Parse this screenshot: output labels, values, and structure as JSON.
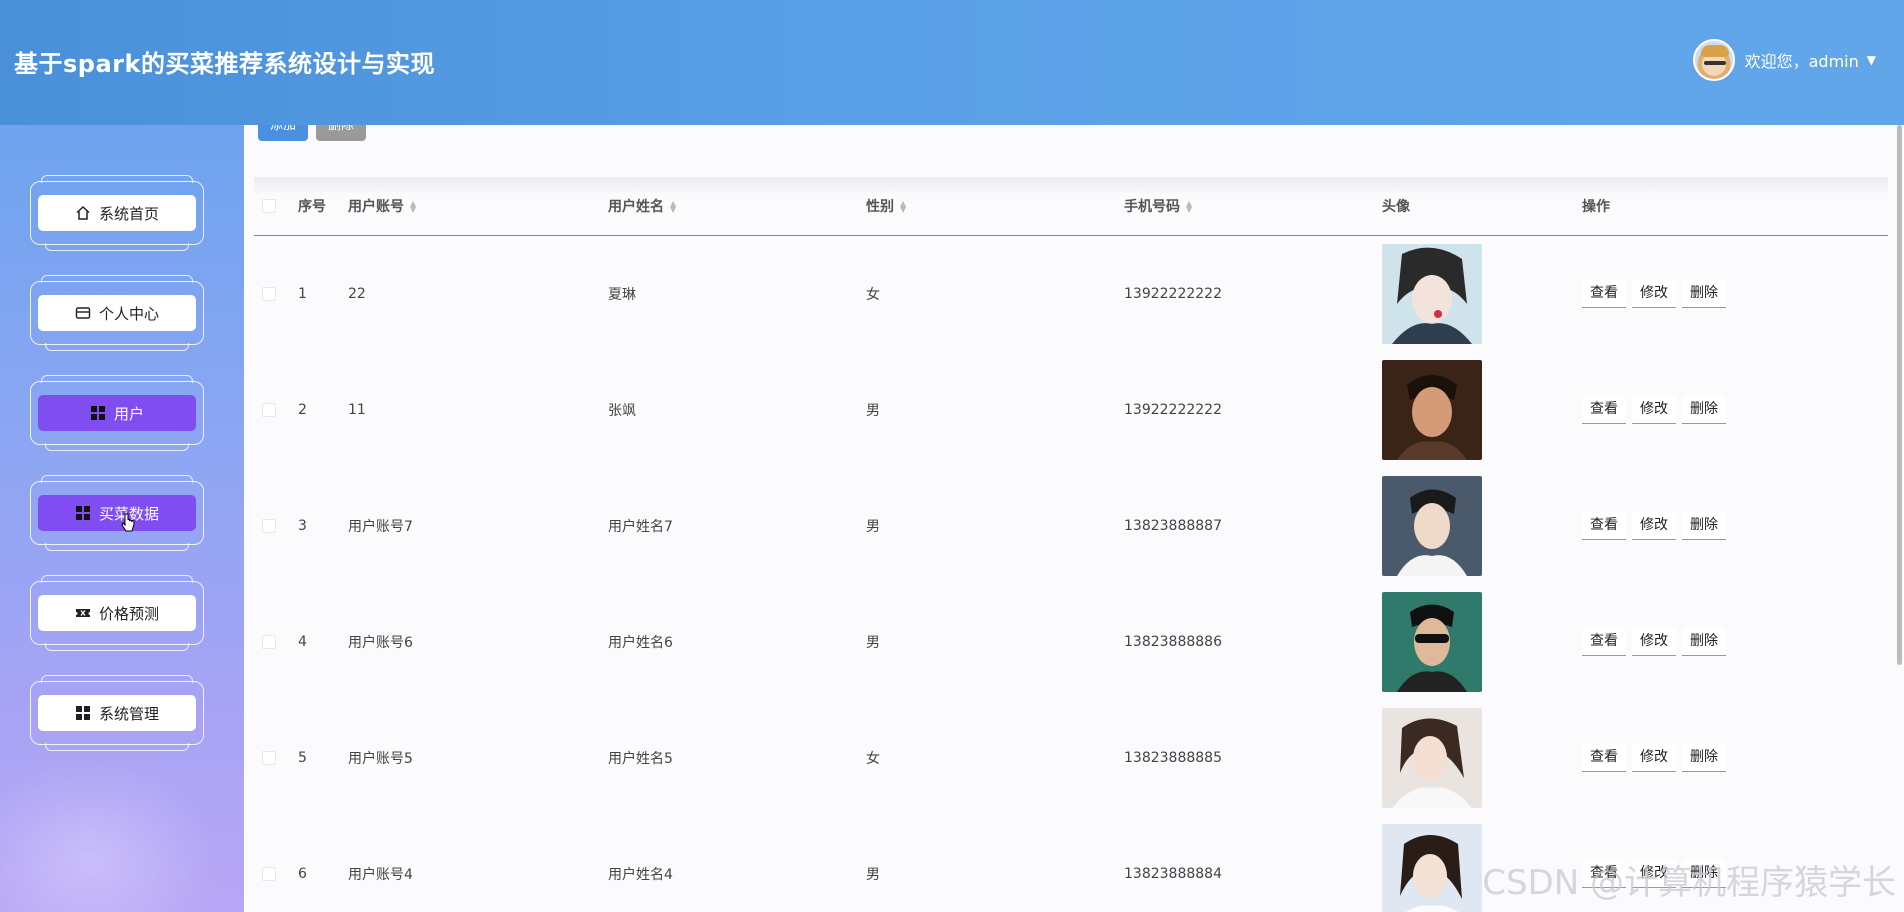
{
  "header": {
    "title": "基于spark的买菜推荐系统设计与实现",
    "welcome": "欢迎您，admin"
  },
  "sidebar": {
    "items": [
      {
        "label": "系统首页",
        "icon": "home-icon",
        "active": false
      },
      {
        "label": "个人中心",
        "icon": "id-card-icon",
        "active": false
      },
      {
        "label": "用户",
        "icon": "grid-icon",
        "active": true
      },
      {
        "label": "买菜数据",
        "icon": "grid-icon",
        "active": true
      },
      {
        "label": "价格预测",
        "icon": "ticket-icon",
        "active": false
      },
      {
        "label": "系统管理",
        "icon": "grid-icon",
        "active": false
      }
    ]
  },
  "toolbar": {
    "add_label": "添加",
    "delete_label": "删除"
  },
  "table": {
    "headers": {
      "index": "序号",
      "account": "用户账号",
      "name": "用户姓名",
      "sex": "性别",
      "phone": "手机号码",
      "avatar": "头像",
      "ops": "操作"
    },
    "op_labels": {
      "view": "查看",
      "edit": "修改",
      "delete": "删除"
    },
    "rows": [
      {
        "index": "1",
        "account": "22",
        "name": "夏琳",
        "sex": "女",
        "phone": "13922222222"
      },
      {
        "index": "2",
        "account": "11",
        "name": "张飒",
        "sex": "男",
        "phone": "13922222222"
      },
      {
        "index": "3",
        "account": "用户账号7",
        "name": "用户姓名7",
        "sex": "男",
        "phone": "13823888887"
      },
      {
        "index": "4",
        "account": "用户账号6",
        "name": "用户姓名6",
        "sex": "男",
        "phone": "13823888886"
      },
      {
        "index": "5",
        "account": "用户账号5",
        "name": "用户姓名5",
        "sex": "女",
        "phone": "13823888885"
      },
      {
        "index": "6",
        "account": "用户账号4",
        "name": "用户姓名4",
        "sex": "男",
        "phone": "13823888884"
      }
    ]
  },
  "watermark": "CSDN @计算机程序猿学长",
  "colors": {
    "header": "#5aa0e6",
    "active_nav": "#7f4df0",
    "add_button": "#4a8fe0",
    "delete_button": "#9a9a9a"
  }
}
